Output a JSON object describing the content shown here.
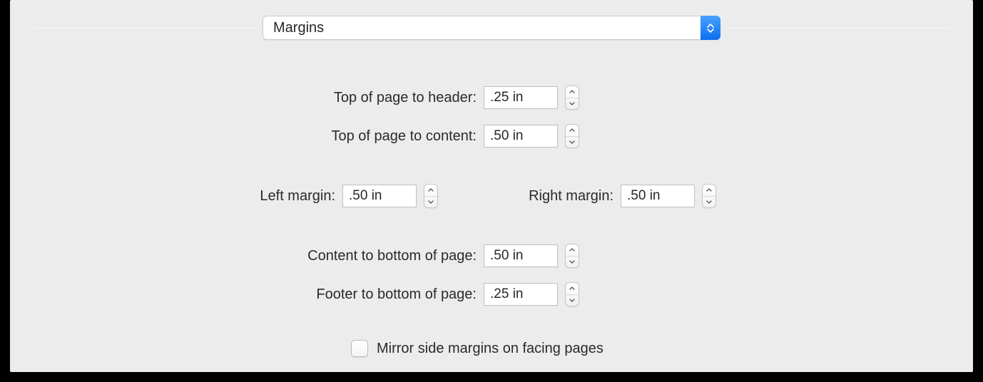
{
  "dropdown": {
    "selected": "Margins"
  },
  "fields": {
    "top_to_header": {
      "label": "Top of page to header:",
      "value": ".25 in"
    },
    "top_to_content": {
      "label": "Top of page to content:",
      "value": ".50 in"
    },
    "left_margin": {
      "label": "Left margin:",
      "value": ".50 in"
    },
    "right_margin": {
      "label": "Right margin:",
      "value": ".50 in"
    },
    "content_to_bottom": {
      "label": "Content to bottom of page:",
      "value": ".50 in"
    },
    "footer_to_bottom": {
      "label": "Footer to bottom of page:",
      "value": ".25 in"
    }
  },
  "mirror": {
    "label": "Mirror side margins on facing pages",
    "checked": false
  }
}
